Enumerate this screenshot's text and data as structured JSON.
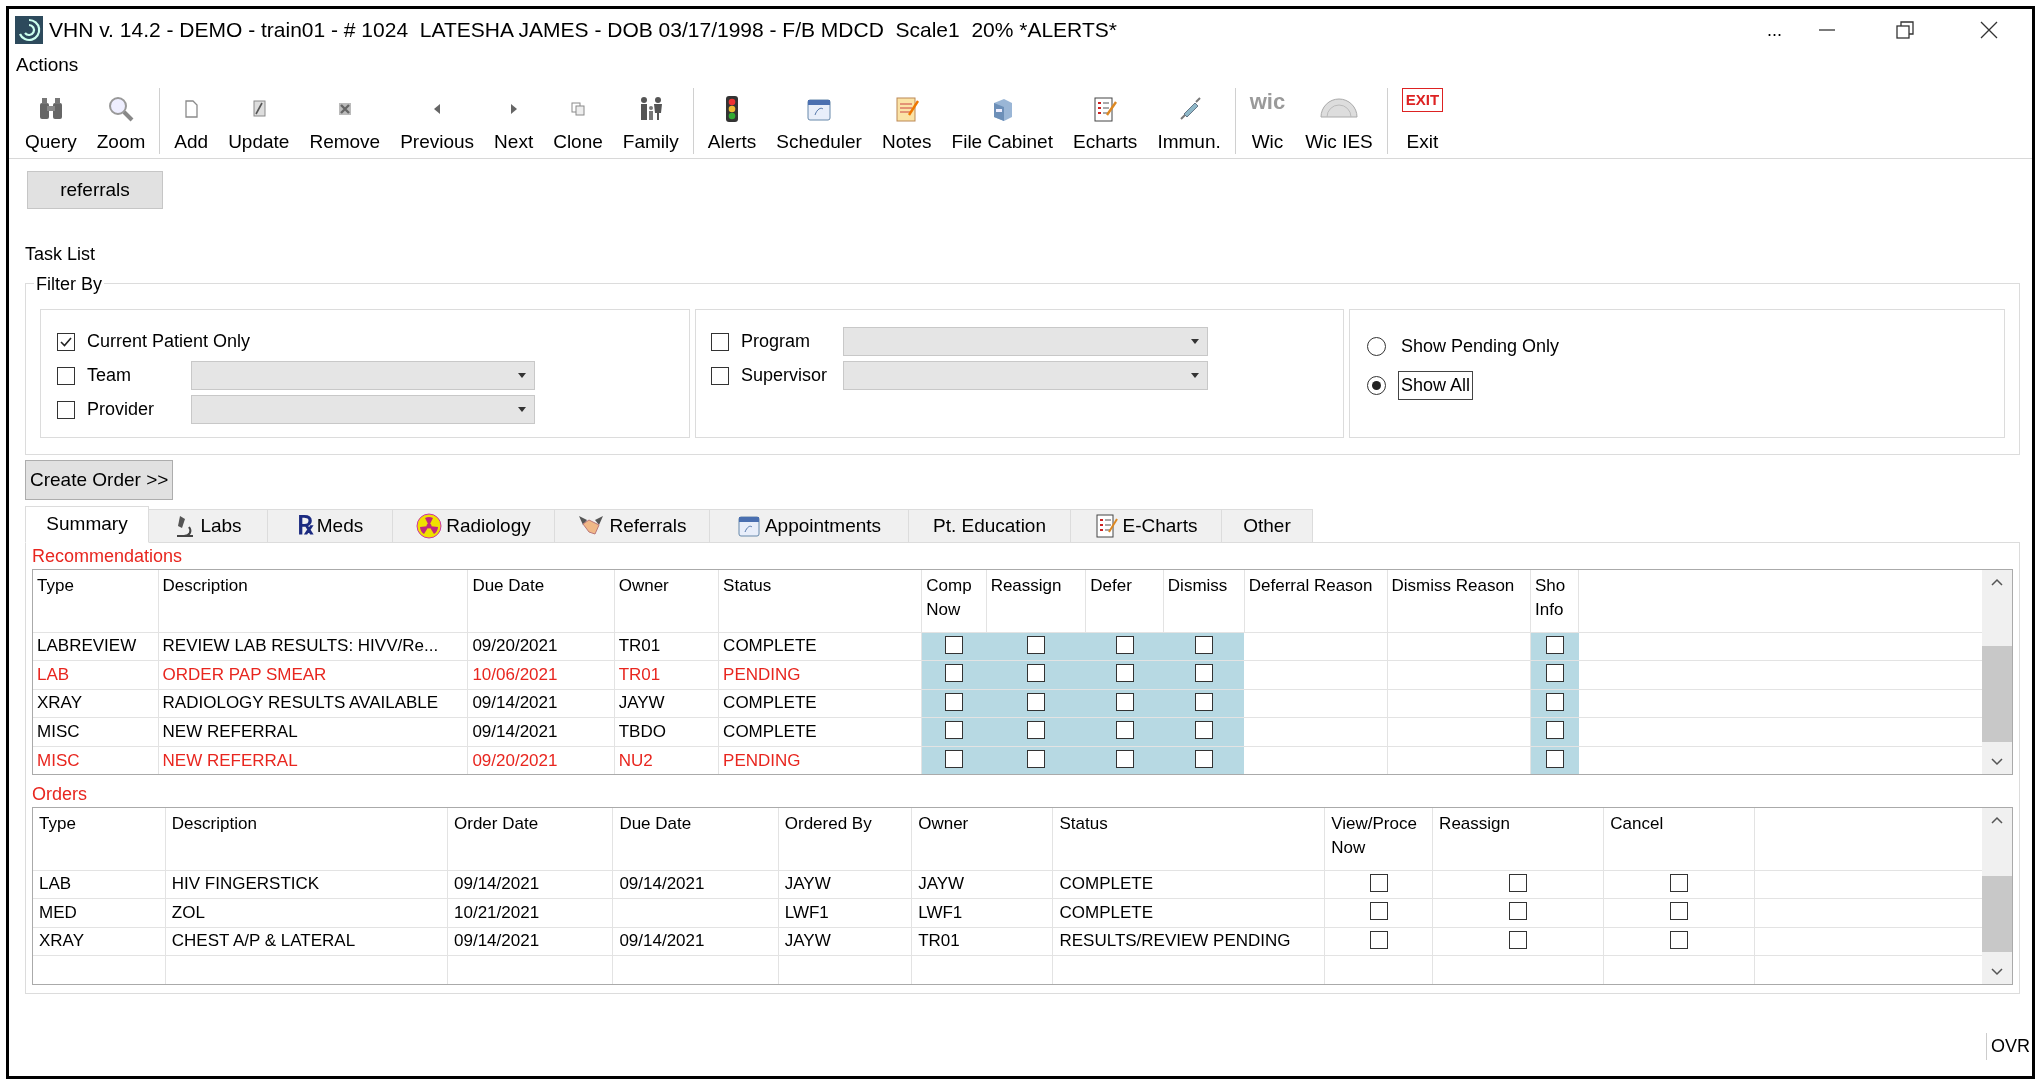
{
  "window": {
    "title": "VHN v. 14.2 - DEMO - train01 - # 1024  LATESHA JAMES - DOB 03/17/1998 - F/B MDCD  Scale1  20% *ALERTS*",
    "overflow": "..."
  },
  "menu": [
    "Actions"
  ],
  "toolbar": [
    [
      {
        "label": "Query"
      },
      {
        "label": "Zoom"
      }
    ],
    [
      {
        "label": "Add"
      },
      {
        "label": "Update"
      },
      {
        "label": "Remove"
      },
      {
        "label": "Previous"
      },
      {
        "label": "Next"
      },
      {
        "label": "Clone"
      },
      {
        "label": "Family"
      }
    ],
    [
      {
        "label": "Alerts"
      },
      {
        "label": "Scheduler"
      },
      {
        "label": "Notes"
      },
      {
        "label": "File Cabinet"
      },
      {
        "label": "Echarts"
      },
      {
        "label": "Immun."
      }
    ],
    [
      {
        "label": "Wic",
        "icon_text": "wic"
      },
      {
        "label": "Wic IES"
      }
    ],
    [
      {
        "label": "Exit",
        "icon_text": "EXIT"
      }
    ]
  ],
  "referrals_button": "referrals",
  "task_list": {
    "title": "Task List",
    "filter_title": "Filter By",
    "patient_filters": [
      {
        "label": "Current Patient Only",
        "checked": true,
        "kind": "checkbox"
      },
      {
        "label": "Team",
        "checked": false,
        "kind": "select"
      },
      {
        "label": "Provider",
        "checked": false,
        "kind": "select"
      }
    ],
    "staff_filters": [
      {
        "label": "Program",
        "checked": false
      },
      {
        "label": "Supervisor",
        "checked": false
      }
    ],
    "pending_options": [
      {
        "label": "Show Pending Only",
        "selected": false
      },
      {
        "label": "Show All",
        "selected": true
      }
    ]
  },
  "create_order_button": "Create Order >>",
  "tabs": [
    {
      "label": "Summary",
      "selected": true
    },
    {
      "label": "Labs",
      "selected": false
    },
    {
      "label": "Meds",
      "selected": false,
      "icon_text": "℞"
    },
    {
      "label": "Radiology",
      "selected": false
    },
    {
      "label": "Referrals",
      "selected": false
    },
    {
      "label": "Appointments",
      "selected": false
    },
    {
      "label": "Pt. Education",
      "selected": false
    },
    {
      "label": "E-Charts",
      "selected": false
    },
    {
      "label": "Other",
      "selected": false
    }
  ],
  "recommendations": {
    "title": "Recommendations",
    "columns": [
      "Type",
      "Description",
      "Due Date",
      "Owner",
      "Status",
      "Comp\nNow",
      "Reassign",
      "Defer",
      "Dismiss",
      "Deferral Reason",
      "Dismiss Reason",
      "Sho\nInfo"
    ],
    "rows": [
      {
        "type": "LABREVIEW",
        "description": "REVIEW LAB RESULTS: HIVV/Re...",
        "due_date": "09/20/2021",
        "owner": "TR01",
        "status": "COMPLETE",
        "color": "#000000",
        "checks": [
          false,
          false,
          false,
          false
        ],
        "show_info": false
      },
      {
        "type": "LAB",
        "description": "ORDER PAP SMEAR",
        "due_date": "10/06/2021",
        "owner": "TR01",
        "status": "PENDING",
        "color": "#e8261f",
        "checks": [
          false,
          false,
          false,
          false
        ],
        "show_info": false
      },
      {
        "type": "XRAY",
        "description": "RADIOLOGY RESULTS AVAILABLE",
        "due_date": "09/14/2021",
        "owner": "JAYW",
        "status": "COMPLETE",
        "color": "#000000",
        "checks": [
          false,
          false,
          false,
          false
        ],
        "show_info": false
      },
      {
        "type": "MISC",
        "description": "NEW REFERRAL",
        "due_date": "09/14/2021",
        "owner": "TBDO",
        "status": "COMPLETE",
        "color": "#000000",
        "checks": [
          false,
          false,
          false,
          false
        ],
        "show_info": false
      },
      {
        "type": "MISC",
        "description": "NEW REFERRAL",
        "due_date": "09/20/2021",
        "owner": "NU2",
        "status": "PENDING",
        "color": "#e8261f",
        "checks": [
          false,
          false,
          false,
          false
        ],
        "show_info": false
      }
    ]
  },
  "orders": {
    "title": "Orders",
    "columns": [
      "Type",
      "Description",
      "Order Date",
      "Due Date",
      "Ordered By",
      "Owner",
      "Status",
      "View/Proce\nNow",
      "Reassign",
      "Cancel"
    ],
    "rows": [
      {
        "type": "LAB",
        "description": "HIV FINGERSTICK",
        "order_date": "09/14/2021",
        "due_date": "09/14/2021",
        "ordered_by": "JAYW",
        "owner": "JAYW",
        "status": "COMPLETE",
        "checks": [
          false,
          false,
          false
        ]
      },
      {
        "type": "MED",
        "description": "ZOL",
        "order_date": "10/21/2021",
        "ordered_by": "LWF1",
        "owner": "LWF1",
        "status": "COMPLETE",
        "checks": [
          false,
          false,
          false
        ]
      },
      {
        "type": "XRAY",
        "description": "CHEST A/P & LATERAL",
        "order_date": "09/14/2021",
        "due_date": "09/14/2021",
        "ordered_by": "JAYW",
        "owner": "TR01",
        "status": "RESULTS/REVIEW PENDING",
        "checks": [
          false,
          false,
          false
        ]
      }
    ]
  },
  "status_bar": {
    "mode": "OVR"
  }
}
